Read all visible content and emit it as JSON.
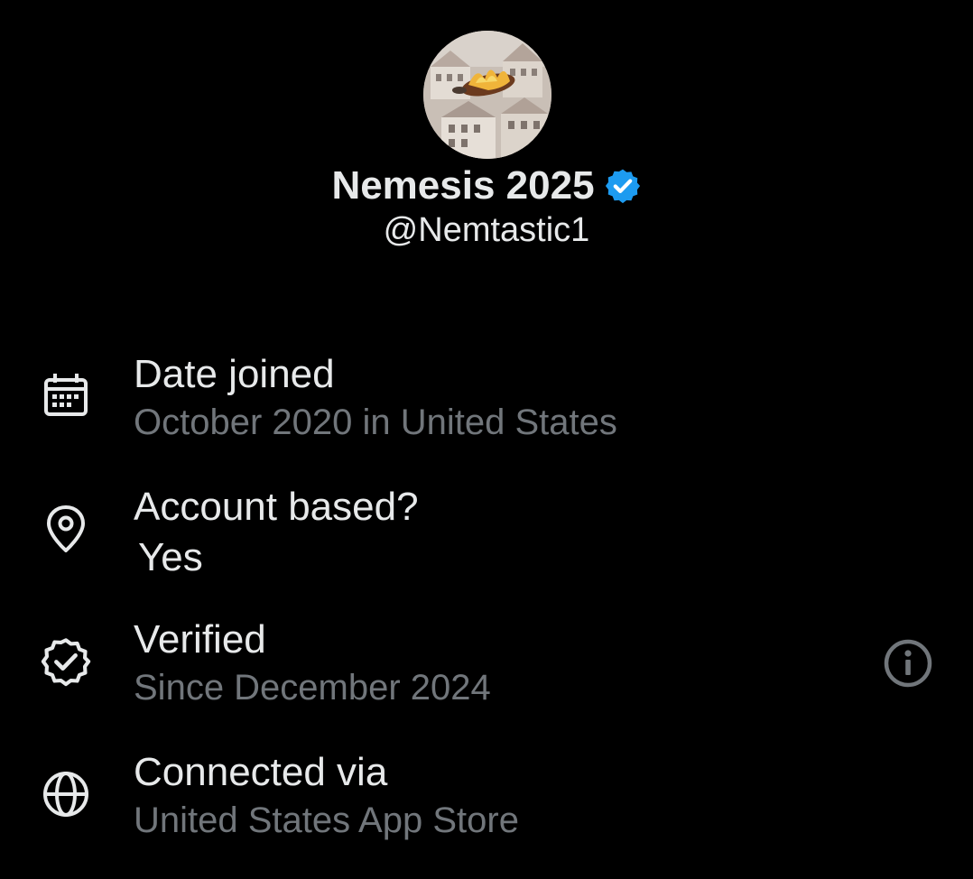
{
  "profile": {
    "display_name": "Nemesis 2025",
    "handle": "@Nemtastic1",
    "verified_badge_icon": "verified-check-icon",
    "badge_color": "#1d9bf0"
  },
  "rows": [
    {
      "icon": "calendar-icon",
      "title": "Date joined",
      "subtitle": "October 2020 in United States"
    },
    {
      "icon": "location-pin-icon",
      "title": "Account based?",
      "subtitle": "Yes"
    },
    {
      "icon": "verified-outline-icon",
      "title": "Verified",
      "subtitle": "Since December 2024",
      "action_icon": "info-icon"
    },
    {
      "icon": "globe-icon",
      "title": "Connected via",
      "subtitle": "United States App Store"
    }
  ],
  "colors": {
    "background": "#000000",
    "primary_text": "#e7e9ea",
    "secondary_text": "#71767b",
    "icon_color": "#e7e9ea",
    "info_icon_color": "#71767b"
  }
}
